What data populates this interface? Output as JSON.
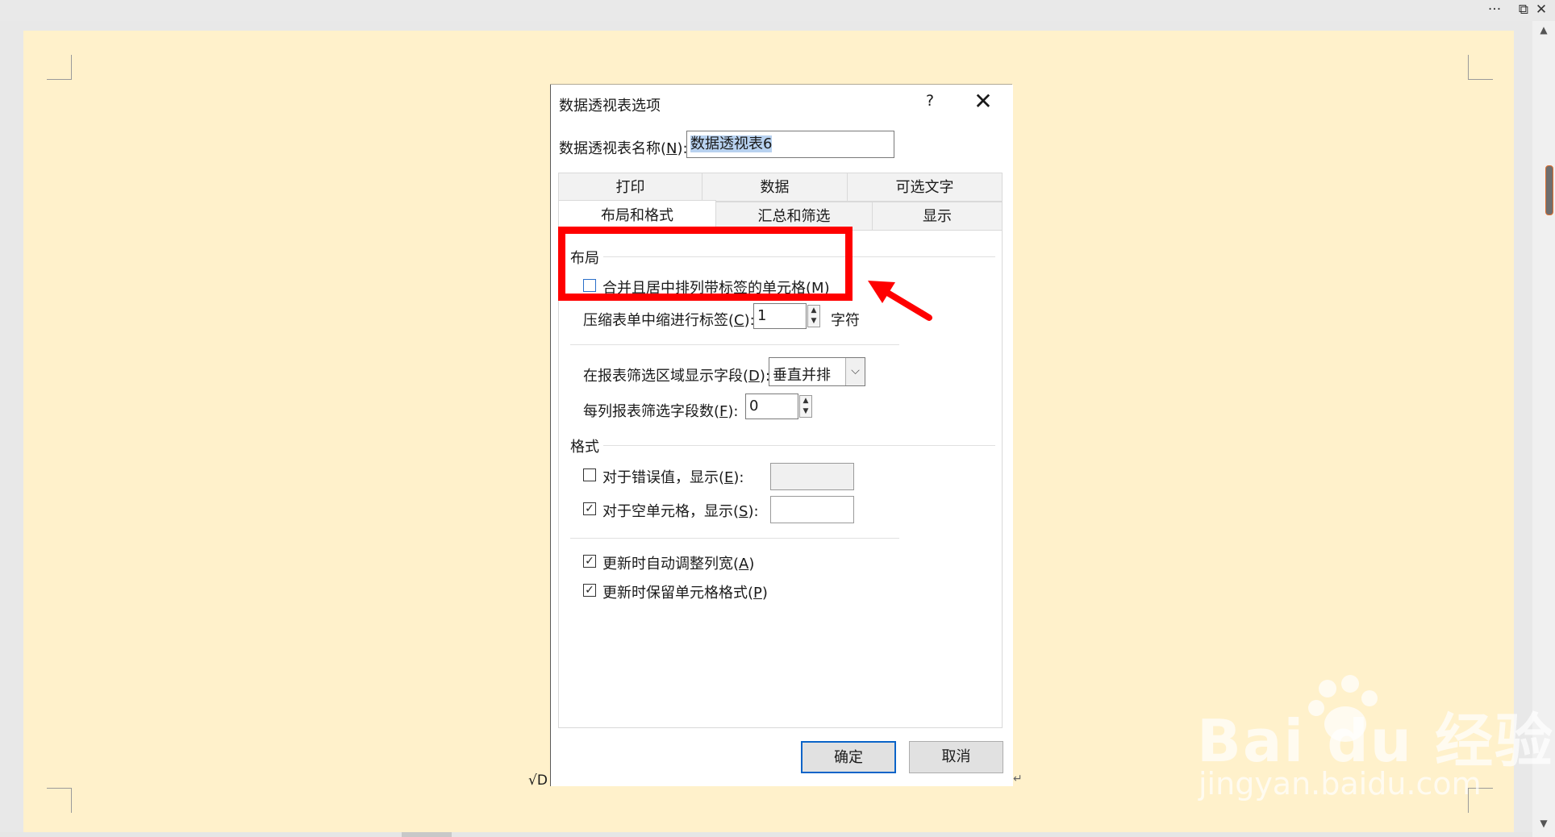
{
  "window": {
    "more_glyph": "···",
    "restore_glyph": "⧉",
    "close_glyph": "✕"
  },
  "scrollbar": {
    "up_glyph": "▲",
    "down_glyph": "▼"
  },
  "document": {
    "behind_text": "√D",
    "para_mark": "↵"
  },
  "dialog": {
    "title": "数据透视表选项",
    "help": "?",
    "close": "✕",
    "name_label_pre": "数据透视表名称(",
    "name_label_key": "N",
    "name_label_post": "):",
    "name_value": "数据透视表6",
    "tabs_row1": [
      "打印",
      "数据",
      "可选文字"
    ],
    "tabs_row2": [
      "布局和格式",
      "汇总和筛选",
      "显示"
    ],
    "active_tab": "布局和格式",
    "layout": {
      "heading": "布局",
      "merge": {
        "pre": "合并且居中排列带标签的单元格(",
        "key": "M",
        "post": ")",
        "checked": false
      },
      "indent": {
        "pre": "压缩表单中缩进行标签(",
        "key": "C",
        "post": "):",
        "value": "1",
        "unit": "字符"
      },
      "filter_area": {
        "pre": "在报表筛选区域显示字段(",
        "key": "D",
        "post": "):",
        "value": "垂直并排",
        "arrow": "⌵"
      },
      "filter_count": {
        "pre": "每列报表筛选字段数(",
        "key": "F",
        "post": "):",
        "value": "0"
      }
    },
    "format": {
      "heading": "格式",
      "error": {
        "pre": "对于错误值，显示(",
        "key": "E",
        "post": "):",
        "checked": false,
        "value": ""
      },
      "empty": {
        "pre": "对于空单元格，显示(",
        "key": "S",
        "post": "):",
        "checked": true,
        "value": ""
      },
      "autofit": {
        "pre": "更新时自动调整列宽(",
        "key": "A",
        "post": ")",
        "checked": true
      },
      "preserve": {
        "pre": "更新时保留单元格格式(",
        "key": "P",
        "post": ")",
        "checked": true
      }
    },
    "ok": "确定",
    "cancel": "取消"
  },
  "annotation": {
    "color": "#ff0000"
  },
  "watermark": {
    "main": "Bai du 经验",
    "sub": "jingyan.baidu.com"
  }
}
